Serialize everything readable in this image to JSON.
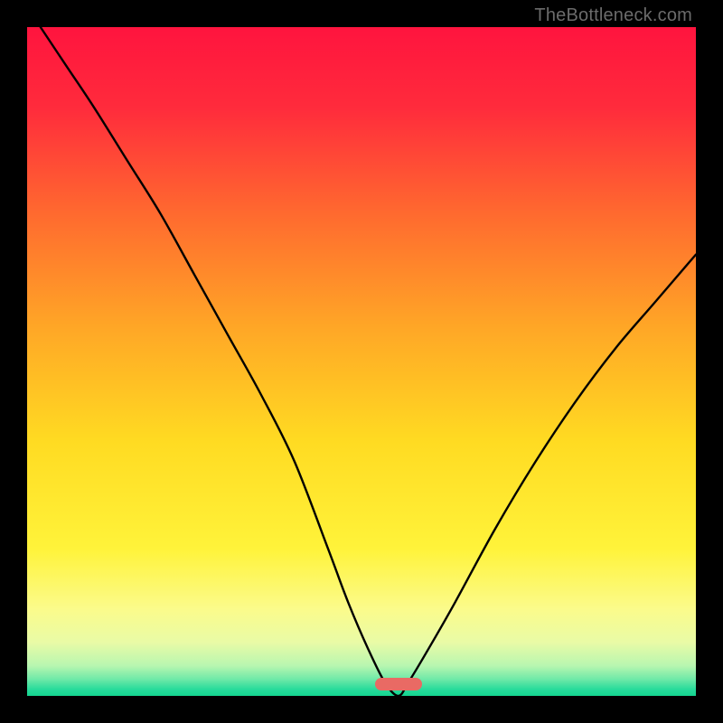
{
  "watermark": {
    "text": "TheBottleneck.com"
  },
  "gradient": {
    "stops": [
      {
        "offset": 0.0,
        "color": "#ff143e"
      },
      {
        "offset": 0.12,
        "color": "#ff2b3c"
      },
      {
        "offset": 0.28,
        "color": "#ff6a2f"
      },
      {
        "offset": 0.45,
        "color": "#ffa726"
      },
      {
        "offset": 0.62,
        "color": "#ffdb22"
      },
      {
        "offset": 0.78,
        "color": "#fff33a"
      },
      {
        "offset": 0.87,
        "color": "#fbfb8b"
      },
      {
        "offset": 0.92,
        "color": "#e9fba6"
      },
      {
        "offset": 0.955,
        "color": "#b8f6b0"
      },
      {
        "offset": 0.975,
        "color": "#6fe9a8"
      },
      {
        "offset": 0.99,
        "color": "#28db9b"
      },
      {
        "offset": 1.0,
        "color": "#14d590"
      }
    ]
  },
  "pill": {
    "color": "#e96a64",
    "cx_frac": 0.555,
    "cy_frac": 0.983,
    "w": 52,
    "h": 14
  },
  "chart_data": {
    "type": "line",
    "title": "",
    "xlabel": "",
    "ylabel": "",
    "xlim": [
      0,
      100
    ],
    "ylim": [
      0,
      100
    ],
    "description": "V-shaped bottleneck curve overlaid on vertical red→yellow→green gradient. Y is bottleneck %, minimum (~0) near x≈55, rising on both sides.",
    "series": [
      {
        "name": "bottleneck-curve",
        "color": "#000000",
        "x": [
          2,
          6,
          10,
          15,
          20,
          25,
          30,
          35,
          40,
          45,
          48,
          51,
          53.5,
          55.5,
          57,
          60,
          64,
          70,
          76,
          82,
          88,
          94,
          100
        ],
        "y": [
          100,
          94,
          88,
          80,
          72,
          63,
          54,
          45,
          35,
          22,
          14,
          7,
          2,
          0,
          2,
          7,
          14,
          25,
          35,
          44,
          52,
          59,
          66
        ]
      }
    ],
    "annotations": [
      {
        "type": "pill",
        "x": 55.5,
        "y": 1.7,
        "color": "#e96a64"
      }
    ]
  }
}
